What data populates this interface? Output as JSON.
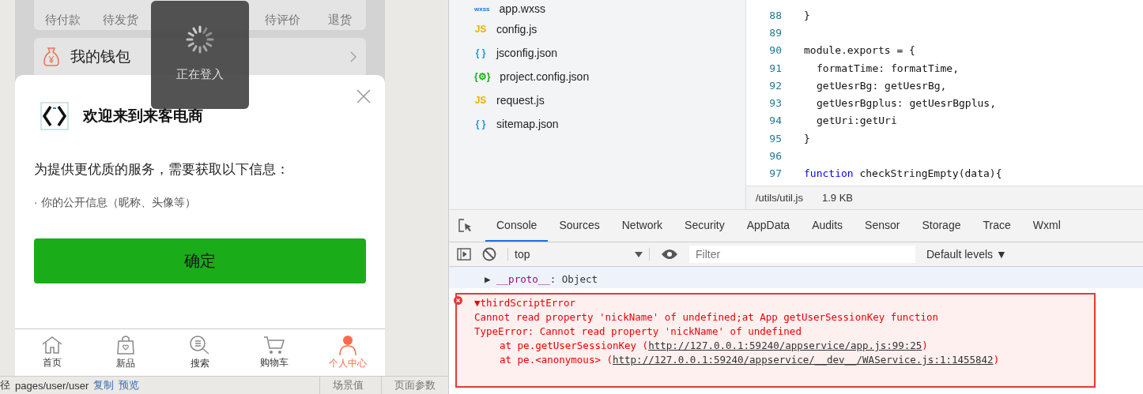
{
  "simulator": {
    "order_tabs": [
      "待付款",
      "待发货",
      "待评价",
      "退货"
    ],
    "wallet": {
      "label": "我的钱包"
    },
    "toast": {
      "text": "正在登入"
    },
    "login_sheet": {
      "title": "欢迎来到来客电商",
      "prompt": "为提供更优质的服务，需要获取以下信息：",
      "item": "· 你的公开信息（昵称、头像等）",
      "confirm": "确定"
    },
    "tab_bar": [
      {
        "label": "首页",
        "selected": false
      },
      {
        "label": "新品",
        "selected": false
      },
      {
        "label": "搜索",
        "selected": false
      },
      {
        "label": "购物车",
        "selected": false
      },
      {
        "label": "个人中心",
        "selected": true
      }
    ]
  },
  "status_bar": {
    "path_label": "径",
    "path": "pages/user/user",
    "actions": [
      "复制",
      "预览"
    ],
    "right": [
      "场景值",
      "页面参数"
    ]
  },
  "file_tree": [
    {
      "name": "app.wxss",
      "badge": "wxss",
      "color": "#1e6fd9"
    },
    {
      "name": "config.js",
      "badge": "JS",
      "color": "#f0b000"
    },
    {
      "name": "jsconfig.json",
      "badge": "{ }",
      "color": "#1e9bd7"
    },
    {
      "name": "project.config.json",
      "badge": "{⚙}",
      "color": "#1aad19"
    },
    {
      "name": "request.js",
      "badge": "JS",
      "color": "#f0b000"
    },
    {
      "name": "sitemap.json",
      "badge": "{ }",
      "color": "#1e9bd7"
    }
  ],
  "editor": {
    "lines": [
      {
        "number": "88",
        "code": "}"
      },
      {
        "number": "89"
      },
      {
        "number": "90",
        "code": "module.exports = {",
        "children": [
          {
            "number": "91",
            "code": "formatTime: formatTime,"
          },
          {
            "number": "92",
            "code": "getUesrBg: getUesrBg,"
          },
          {
            "number": "93",
            "code": "getUesrBgplus: getUesrBgplus,"
          },
          {
            "number": "94",
            "code": "getUri:getUri"
          }
        ]
      },
      {
        "number": "95",
        "code": "}"
      },
      {
        "number": "96"
      },
      {
        "number": "97",
        "keyword": "function",
        "code": " checkStringEmpty(data){"
      }
    ],
    "file_path": "/utils/util.js",
    "file_size": "1.9 KB"
  },
  "devtools": {
    "tabs": [
      {
        "label": "Console",
        "selected": true
      },
      {
        "label": "Sources",
        "selected": false
      },
      {
        "label": "Network",
        "selected": false
      },
      {
        "label": "Security",
        "selected": false
      },
      {
        "label": "AppData",
        "selected": false
      },
      {
        "label": "Audits",
        "selected": false
      },
      {
        "label": "Sensor",
        "selected": false
      },
      {
        "label": "Storage",
        "selected": false
      },
      {
        "label": "Trace",
        "selected": false
      },
      {
        "label": "Wxml",
        "selected": false
      }
    ],
    "context": "top",
    "filter": {
      "placeholder": "Filter"
    },
    "levels": "Default levels ▼",
    "log_line": {
      "arrow": "▶",
      "key": "__proto__",
      "value": ": Object"
    },
    "error": {
      "title": "▼thirdScriptError",
      "message": "Cannot read property 'nickName' of undefined;at App getUserSessionKey function",
      "type_line": "TypeError: Cannot read property 'nickName' of undefined",
      "frames": [
        {
          "text": "at pe.getUserSessionKey (",
          "link": "http://127.0.0.1:59240/appservice/app.js:99:25",
          "after": ")"
        },
        {
          "text": "at pe.<anonymous> (",
          "link": "http://127.0.0.1:59240/appservice/__dev__/WAService.js:1:1455842",
          "after": ")"
        }
      ]
    }
  }
}
